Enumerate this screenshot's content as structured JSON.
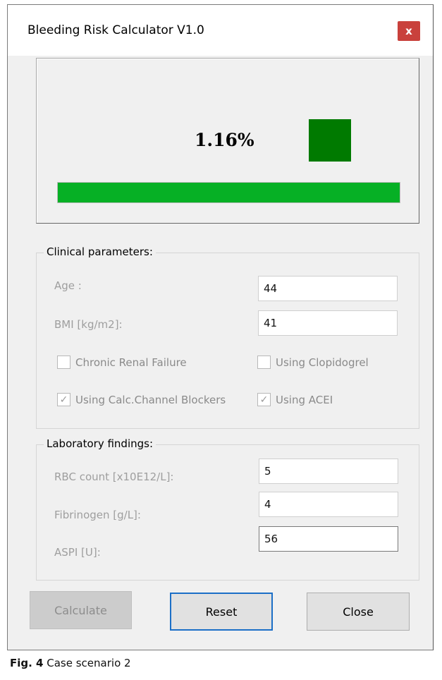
{
  "window": {
    "title": "Bleeding Risk Calculator V1.0",
    "close_glyph": "x"
  },
  "result": {
    "risk_text": "1.16%",
    "indicator_color": "#007a00",
    "progress_percent": 100,
    "progress_color": "#06b025"
  },
  "clinical": {
    "legend": "Clinical parameters:",
    "age_label": "Age :",
    "age_value": "44",
    "bmi_label": "BMI [kg/m2]:",
    "bmi_value": "41",
    "checkboxes": [
      {
        "label": "Chronic Renal Failure",
        "checked": false
      },
      {
        "label": "Using Clopidogrel",
        "checked": false
      },
      {
        "label": "Using Calc.Channel Blockers",
        "checked": true
      },
      {
        "label": "Using ACEI",
        "checked": true
      }
    ]
  },
  "lab": {
    "legend": "Laboratory findings:",
    "rbc_label": "RBC count [x10E12/L]:",
    "rbc_value": "5",
    "fib_label": "Fibrinogen [g/L]:",
    "fib_value": "4",
    "aspi_label": "ASPI [U]:",
    "aspi_value": "56"
  },
  "buttons": {
    "calculate": "Calculate",
    "reset": "Reset",
    "close": "Close"
  },
  "caption": {
    "fig": "Fig. 4",
    "text": "Case scenario 2"
  },
  "icons": {
    "check": "✓"
  }
}
